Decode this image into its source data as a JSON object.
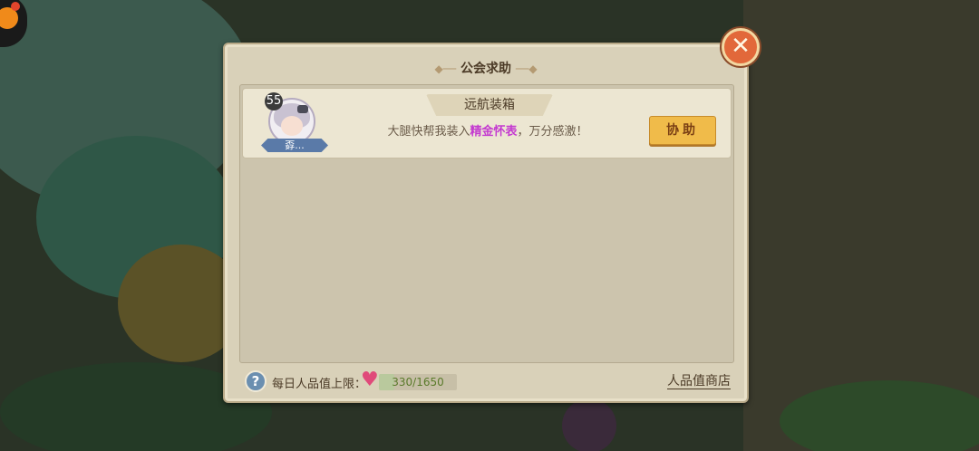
{
  "dialog": {
    "title": "公会求助",
    "close_symbol": "✕"
  },
  "request": {
    "category": "远航装箱",
    "level": "55",
    "player_name": "孬...",
    "text_before": "大腿快帮我装入",
    "highlight_item": "精金怀表",
    "text_after": "，万分感激！",
    "assist_label": "协助"
  },
  "footer": {
    "help_symbol": "?",
    "limit_label": "每日人品值上限：",
    "limit_value": "330/1650",
    "limit_fraction": 0.2,
    "heart_symbol": "♥",
    "shop_label": "人品值商店"
  },
  "colors": {
    "highlight": "#c43bd0",
    "assist_button": "#f0bb4a",
    "close_button": "#e2683a"
  }
}
